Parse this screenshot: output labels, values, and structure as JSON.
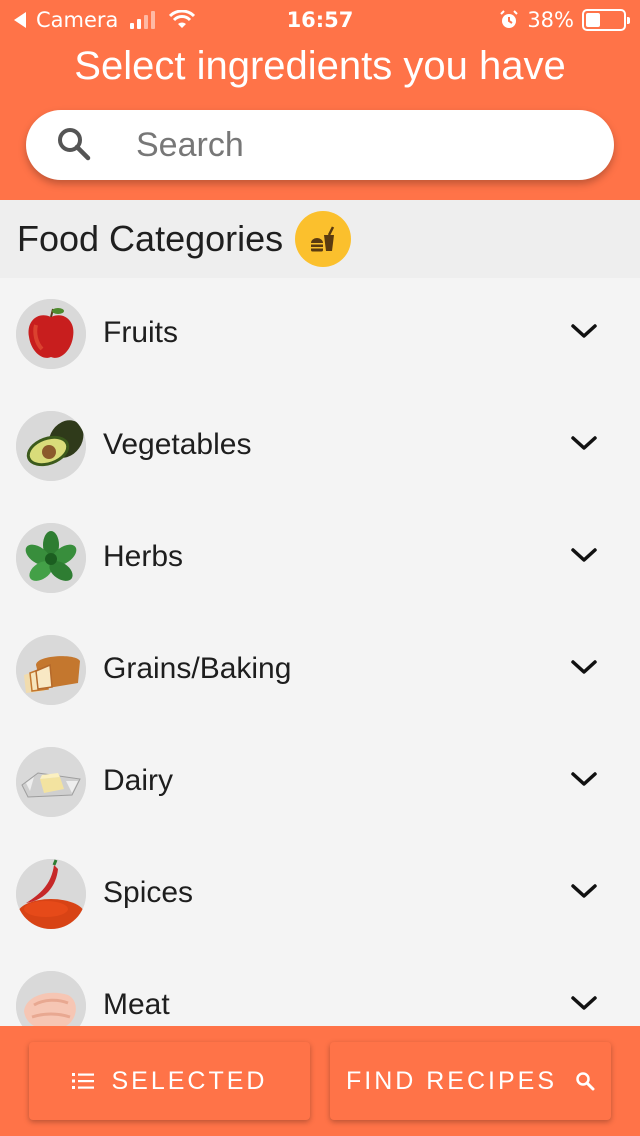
{
  "status_bar": {
    "back_app": "Camera",
    "time": "16:57",
    "battery_percent": "38%",
    "battery_level": 0.38
  },
  "header": {
    "title": "Select ingredients you have"
  },
  "search": {
    "placeholder": "Search",
    "icon": "search-icon"
  },
  "section": {
    "title": "Food Categories",
    "badge_icon": "food-drink-icon",
    "badge_color": "#fbc02d"
  },
  "categories": [
    {
      "label": "Fruits",
      "image": "apple"
    },
    {
      "label": "Vegetables",
      "image": "avocado"
    },
    {
      "label": "Herbs",
      "image": "basil"
    },
    {
      "label": "Grains/Baking",
      "image": "bread"
    },
    {
      "label": "Dairy",
      "image": "butter"
    },
    {
      "label": "Spices",
      "image": "chili-powder"
    },
    {
      "label": "Meat",
      "image": "chicken"
    }
  ],
  "bottom_bar": {
    "selected_label": "SELECTED",
    "find_label": "FIND RECIPES"
  },
  "colors": {
    "accent": "#ff7348",
    "background": "#f4f4f4",
    "section_bg": "#eeeeee"
  }
}
